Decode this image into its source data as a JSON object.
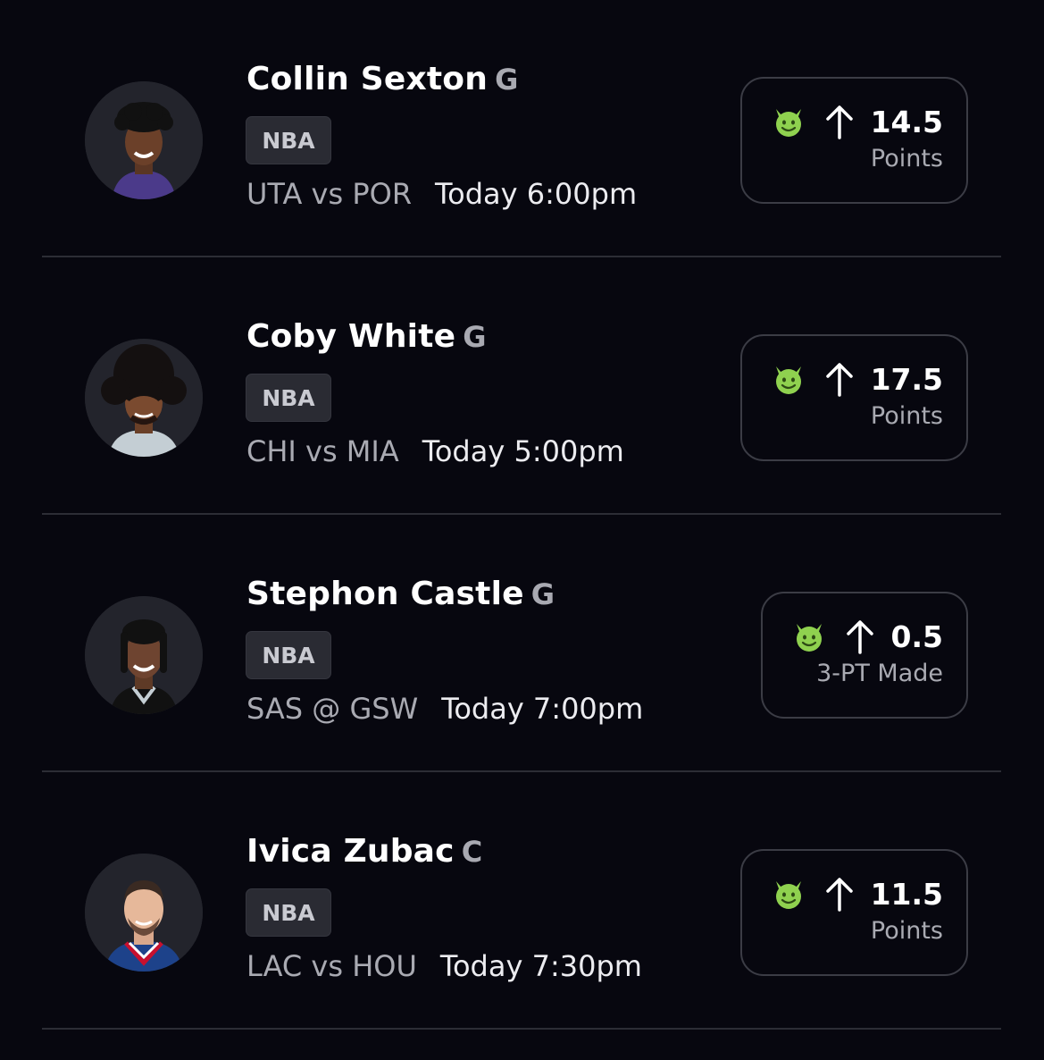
{
  "picks": [
    {
      "player_name": "Collin Sexton",
      "position": "G",
      "league": "NBA",
      "matchup": "UTA vs POR",
      "game_time": "Today 6:00pm",
      "projection_value": "14.5",
      "stat_type": "Points",
      "avatar_icon": "player-headshot",
      "jersey_color": "#4b3a8a",
      "hair": "curly"
    },
    {
      "player_name": "Coby White",
      "position": "G",
      "league": "NBA",
      "matchup": "CHI vs MIA",
      "game_time": "Today 5:00pm",
      "projection_value": "17.5",
      "stat_type": "Points",
      "avatar_icon": "player-headshot",
      "jersey_color": "#c4ced4",
      "hair": "afro"
    },
    {
      "player_name": "Stephon Castle",
      "position": "G",
      "league": "NBA",
      "matchup": "SAS @ GSW",
      "game_time": "Today 7:00pm",
      "projection_value": "0.5",
      "stat_type": "3-PT Made",
      "avatar_icon": "player-headshot",
      "jersey_color": "#111111",
      "hair": "braids"
    },
    {
      "player_name": "Ivica Zubac",
      "position": "C",
      "league": "NBA",
      "matchup": "LAC vs HOU",
      "game_time": "Today 7:30pm",
      "projection_value": "11.5",
      "stat_type": "Points",
      "avatar_icon": "player-headshot",
      "jersey_color": "#1d428a",
      "hair": "short"
    }
  ],
  "icons": {
    "demon": "demon-icon",
    "direction": "arrow-up-icon"
  },
  "colors": {
    "background": "#07070f",
    "demon_green": "#8fd14f",
    "muted_text": "#a9aab2",
    "card_border": "#3b3c45"
  }
}
